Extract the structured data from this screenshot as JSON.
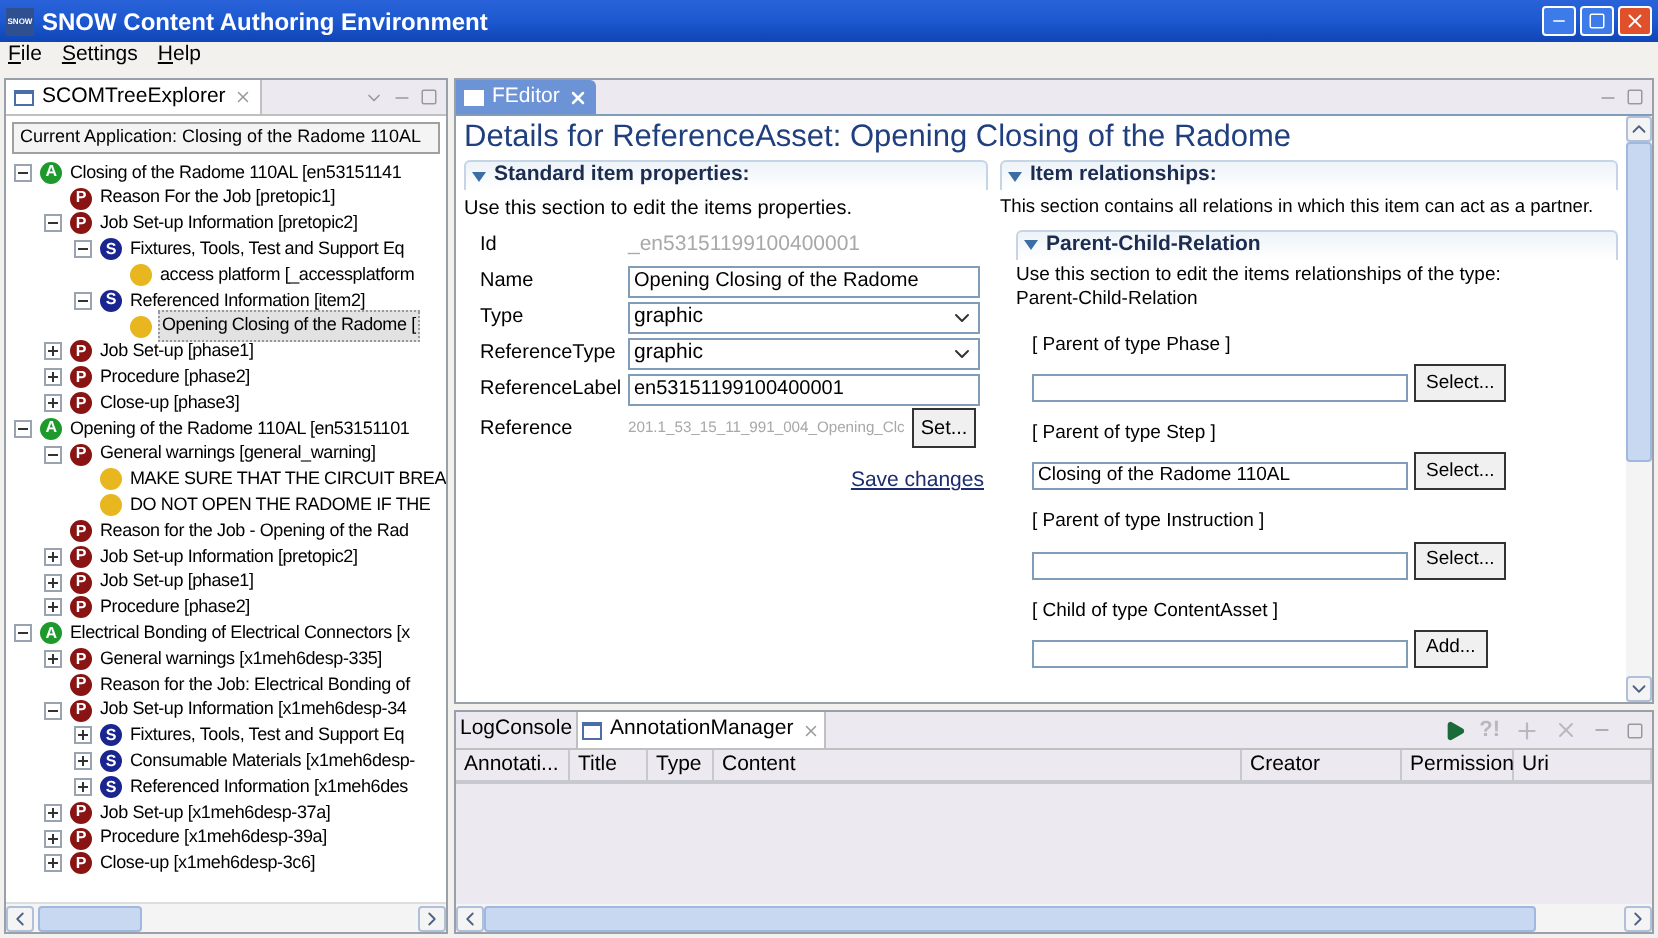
{
  "window": {
    "title": "SNOW Content Authoring Environment",
    "logo": "SNOW"
  },
  "menu": [
    "File",
    "Settings",
    "Help"
  ],
  "explorer": {
    "tab": "SCOMTreeExplorer",
    "current_application": "Current Application: Closing of the Radome 110AL",
    "items": [
      {
        "badge": "A",
        "color": "#1e9a2c",
        "label": "Closing of the Radome 110AL [en53151141",
        "expanded": true,
        "selected": false,
        "children": [
          {
            "badge": "P",
            "color": "#8a1414",
            "label": "Reason For the Job [pretopic1]",
            "selected": false
          },
          {
            "badge": "P",
            "color": "#8a1414",
            "label": "Job Set-up Information [pretopic2]",
            "expanded": true,
            "selected": false,
            "children": [
              {
                "badge": "S",
                "color": "#1a2590",
                "label": "Fixtures, Tools, Test and Support Eq",
                "expanded": true,
                "selected": false,
                "children": [
                  {
                    "color": "#e8b61e",
                    "label": "access platform [_accessplatform",
                    "selected": false
                  }
                ]
              },
              {
                "badge": "S",
                "color": "#1a2590",
                "label": "Referenced Information [item2]",
                "expanded": true,
                "selected": false,
                "children": [
                  {
                    "color": "#e8b61e",
                    "label": "Opening Closing of the Radome [",
                    "selected": true
                  }
                ]
              }
            ]
          },
          {
            "badge": "P",
            "color": "#8a1414",
            "label": "Job Set-up [phase1]",
            "expanded": false,
            "selected": false
          },
          {
            "badge": "P",
            "color": "#8a1414",
            "label": "Procedure [phase2]",
            "expanded": false,
            "selected": false
          },
          {
            "badge": "P",
            "color": "#8a1414",
            "label": "Close-up [phase3]",
            "expanded": false,
            "selected": false
          }
        ]
      },
      {
        "badge": "A",
        "color": "#1e9a2c",
        "label": "Opening of the Radome 110AL [en53151101",
        "expanded": true,
        "selected": false,
        "children": [
          {
            "badge": "P",
            "color": "#8a1414",
            "label": "General warnings [general_warning]",
            "expanded": true,
            "selected": false,
            "children": [
              {
                "color": "#e8b61e",
                "label": "MAKE SURE THAT THE CIRCUIT BREA",
                "selected": false
              },
              {
                "color": "#e8b61e",
                "label": "DO NOT OPEN THE RADOME IF THE",
                "selected": false
              }
            ]
          },
          {
            "badge": "P",
            "color": "#8a1414",
            "label": "Reason for the Job - Opening of the Rad",
            "selected": false
          },
          {
            "badge": "P",
            "color": "#8a1414",
            "label": "Job Set-up Information [pretopic2]",
            "expanded": false,
            "selected": false
          },
          {
            "badge": "P",
            "color": "#8a1414",
            "label": "Job Set-up [phase1]",
            "expanded": false,
            "selected": false
          },
          {
            "badge": "P",
            "color": "#8a1414",
            "label": "Procedure [phase2]",
            "expanded": false,
            "selected": false
          }
        ]
      },
      {
        "badge": "A",
        "color": "#1e9a2c",
        "label": "Electrical Bonding of Electrical Connectors [x",
        "expanded": true,
        "selected": false,
        "children": [
          {
            "badge": "P",
            "color": "#8a1414",
            "label": "General warnings [x1meh6desp-335]",
            "expanded": false,
            "selected": false
          },
          {
            "badge": "P",
            "color": "#8a1414",
            "label": "Reason for the Job: Electrical Bonding of",
            "selected": false
          },
          {
            "badge": "P",
            "color": "#8a1414",
            "label": "Job Set-up Information [x1meh6desp-34",
            "expanded": true,
            "selected": false,
            "children": [
              {
                "badge": "S",
                "color": "#1a2590",
                "label": "Fixtures, Tools, Test and Support Eq",
                "expanded": false,
                "selected": false
              },
              {
                "badge": "S",
                "color": "#1a2590",
                "label": "Consumable Materials [x1meh6desp-",
                "expanded": false,
                "selected": false
              },
              {
                "badge": "S",
                "color": "#1a2590",
                "label": "Referenced Information [x1meh6des",
                "expanded": false,
                "selected": false
              }
            ]
          },
          {
            "badge": "P",
            "color": "#8a1414",
            "label": "Job Set-up [x1meh6desp-37a]",
            "expanded": false,
            "selected": false
          },
          {
            "badge": "P",
            "color": "#8a1414",
            "label": "Procedure [x1meh6desp-39a]",
            "expanded": false,
            "selected": false
          },
          {
            "badge": "P",
            "color": "#8a1414",
            "label": "Close-up [x1meh6desp-3c6]",
            "expanded": false,
            "selected": false
          }
        ]
      }
    ]
  },
  "editor": {
    "tab": "FEditor",
    "heading": "Details for ReferenceAsset: Opening Closing of the Radome",
    "standard": {
      "title": "Standard item properties:",
      "expanded": true,
      "description": "Use this section to edit the items properties.",
      "fields": [
        {
          "label": "Id",
          "kind": "readonly",
          "value": "_en53151199100400001"
        },
        {
          "label": "Name",
          "kind": "text",
          "value": "Opening Closing of the Radome"
        },
        {
          "label": "Type",
          "kind": "select",
          "value": "graphic"
        },
        {
          "label": "ReferenceType",
          "kind": "select",
          "value": "graphic"
        },
        {
          "label": "ReferenceLabel",
          "kind": "text",
          "value": "en53151199100400001"
        },
        {
          "label": "Reference",
          "kind": "button",
          "value": "201.1_53_15_11_991_004_Opening_Clc",
          "button": "Set..."
        }
      ],
      "save_link": "Save changes"
    },
    "relationships": {
      "title": "Item relationships:",
      "expanded": true,
      "description": "This section contains all relations in which this item can act as a partner.",
      "subsection": {
        "title": "Parent-Child-Relation",
        "expanded": true,
        "description_lines": [
          "Use this section to edit the items relationships of the type:",
          "Parent-Child-Relation"
        ],
        "slots": [
          {
            "label": "[ Parent of type Phase ]",
            "button": "Select..."
          },
          {
            "label": "[ Parent of type Step ]",
            "value": "Closing of the Radome 110AL",
            "button": "Select..."
          },
          {
            "label": "[ Parent of type Instruction ]",
            "button": "Select..."
          },
          {
            "label": "[ Child of type ContentAsset ]",
            "button": "Add..."
          }
        ]
      }
    }
  },
  "bottom": {
    "tabs": [
      {
        "label": "LogConsole",
        "selected": false
      },
      {
        "label": "AnnotationManager",
        "selected": true
      }
    ],
    "toolbar": [
      {
        "kind": "run",
        "disabled": false
      },
      {
        "kind": "help",
        "label": "?!",
        "disabled": true
      },
      {
        "kind": "add",
        "disabled": true
      },
      {
        "kind": "delete",
        "disabled": true
      }
    ],
    "columns": [
      "Annotati...",
      "Title",
      "Type",
      "Content",
      "Creator",
      "Permission",
      "Uri"
    ]
  }
}
